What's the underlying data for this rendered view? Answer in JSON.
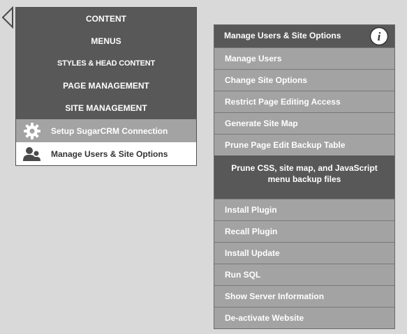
{
  "left_menu": {
    "items": [
      {
        "label": "CONTENT"
      },
      {
        "label": "MENUS"
      },
      {
        "label": "STYLES & HEAD CONTENT"
      },
      {
        "label": "PAGE MANAGEMENT"
      },
      {
        "label": "SITE MANAGEMENT"
      }
    ],
    "sub_items": [
      {
        "label": "Setup SugarCRM Connection",
        "icon": "gear-icon"
      },
      {
        "label": "Manage Users & Site Options",
        "icon": "users-icon"
      }
    ]
  },
  "right_panel": {
    "title": "Manage Users & Site Options",
    "info_icon": "info-icon",
    "items": [
      {
        "label": "Manage Users"
      },
      {
        "label": "Change Site Options"
      },
      {
        "label": "Restrict Page Editing Access"
      },
      {
        "label": "Generate Site Map"
      },
      {
        "label": "Prune Page Edit Backup Table"
      },
      {
        "label": "Prune CSS, site map, and JavaScript menu backup files"
      },
      {
        "label": "Install Plugin"
      },
      {
        "label": "Recall Plugin"
      },
      {
        "label": "Install Update"
      },
      {
        "label": "Run SQL"
      },
      {
        "label": "Show Server Information"
      },
      {
        "label": "De-activate Website"
      }
    ]
  },
  "colors": {
    "background": "#d9d9d9",
    "dark_item": "#585858",
    "light_item": "#a3a3a3",
    "selected_item": "#ffffff"
  }
}
